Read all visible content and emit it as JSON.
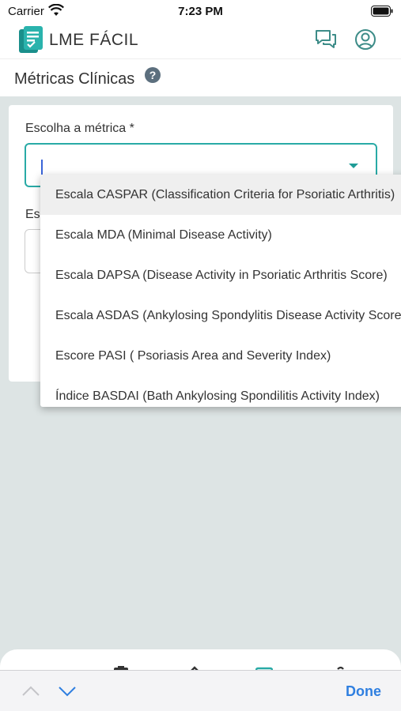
{
  "status": {
    "carrier": "Carrier",
    "time": "7:23 PM"
  },
  "header": {
    "app_name": "LME FÁCIL"
  },
  "page": {
    "title": "Métricas Clínicas"
  },
  "form": {
    "metric_label": "Escolha a métrica *",
    "metric_value": "",
    "second_label": "Es"
  },
  "dropdown": {
    "options": [
      "Escala CASPAR (Classification Criteria for Psoriatic Arthritis)",
      "Escala MDA (Minimal Disease Activity)",
      "Escala DAPSA (Disease Activity in Psoriatic Arthritis Score)",
      "Escala ASDAS (Ankylosing Spondylitis Disease Activity Score)",
      "Escore PASI ( Psoriasis Area and Severity Index)",
      "Índice BASDAI (Bath Ankylosing Spondilitis Activity Index)"
    ]
  },
  "keyboard_toolbar": {
    "done_label": "Done"
  },
  "colors": {
    "accent": "#29aaa6",
    "done": "#2f7fe0",
    "caret": "#3a64d8"
  }
}
